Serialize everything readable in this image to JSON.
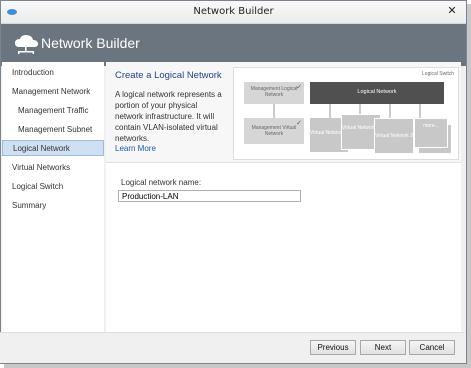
{
  "window": {
    "title": "Network Builder",
    "close_glyph": "✕"
  },
  "banner": {
    "title": "Network Builder",
    "icon": "cloud-icon"
  },
  "nav": {
    "items": [
      {
        "label": "Introduction"
      },
      {
        "label": "Management Network"
      },
      {
        "label": "Management Traffic"
      },
      {
        "label": "Management Subnet"
      },
      {
        "label": "Logical Network"
      },
      {
        "label": "Virtual Networks"
      },
      {
        "label": "Logical Switch"
      },
      {
        "label": "Summary"
      }
    ],
    "selected": "Logical Network"
  },
  "content": {
    "heading": "Create a Logical Network",
    "description": "A logical network represents a portion of your physical network infrastructure. It will contain VLAN-isolated virtual networks.",
    "learn_more": "Learn More"
  },
  "diagram": {
    "switch_label": "Logical Switch",
    "mgmt_logical": "Management Logical Network",
    "logical_network": "Logical Network",
    "mgmt_virtual": "Management Virtual Network",
    "vn1": "Virtual Network 1",
    "vn2": "Virtual Network 2",
    "vn3": "Virtual Network 3",
    "more": "more..."
  },
  "form": {
    "name_label": "Logical network name:",
    "name_value": "Production-LAN"
  },
  "buttons": {
    "previous": "Previous",
    "next": "Next",
    "cancel": "Cancel"
  }
}
